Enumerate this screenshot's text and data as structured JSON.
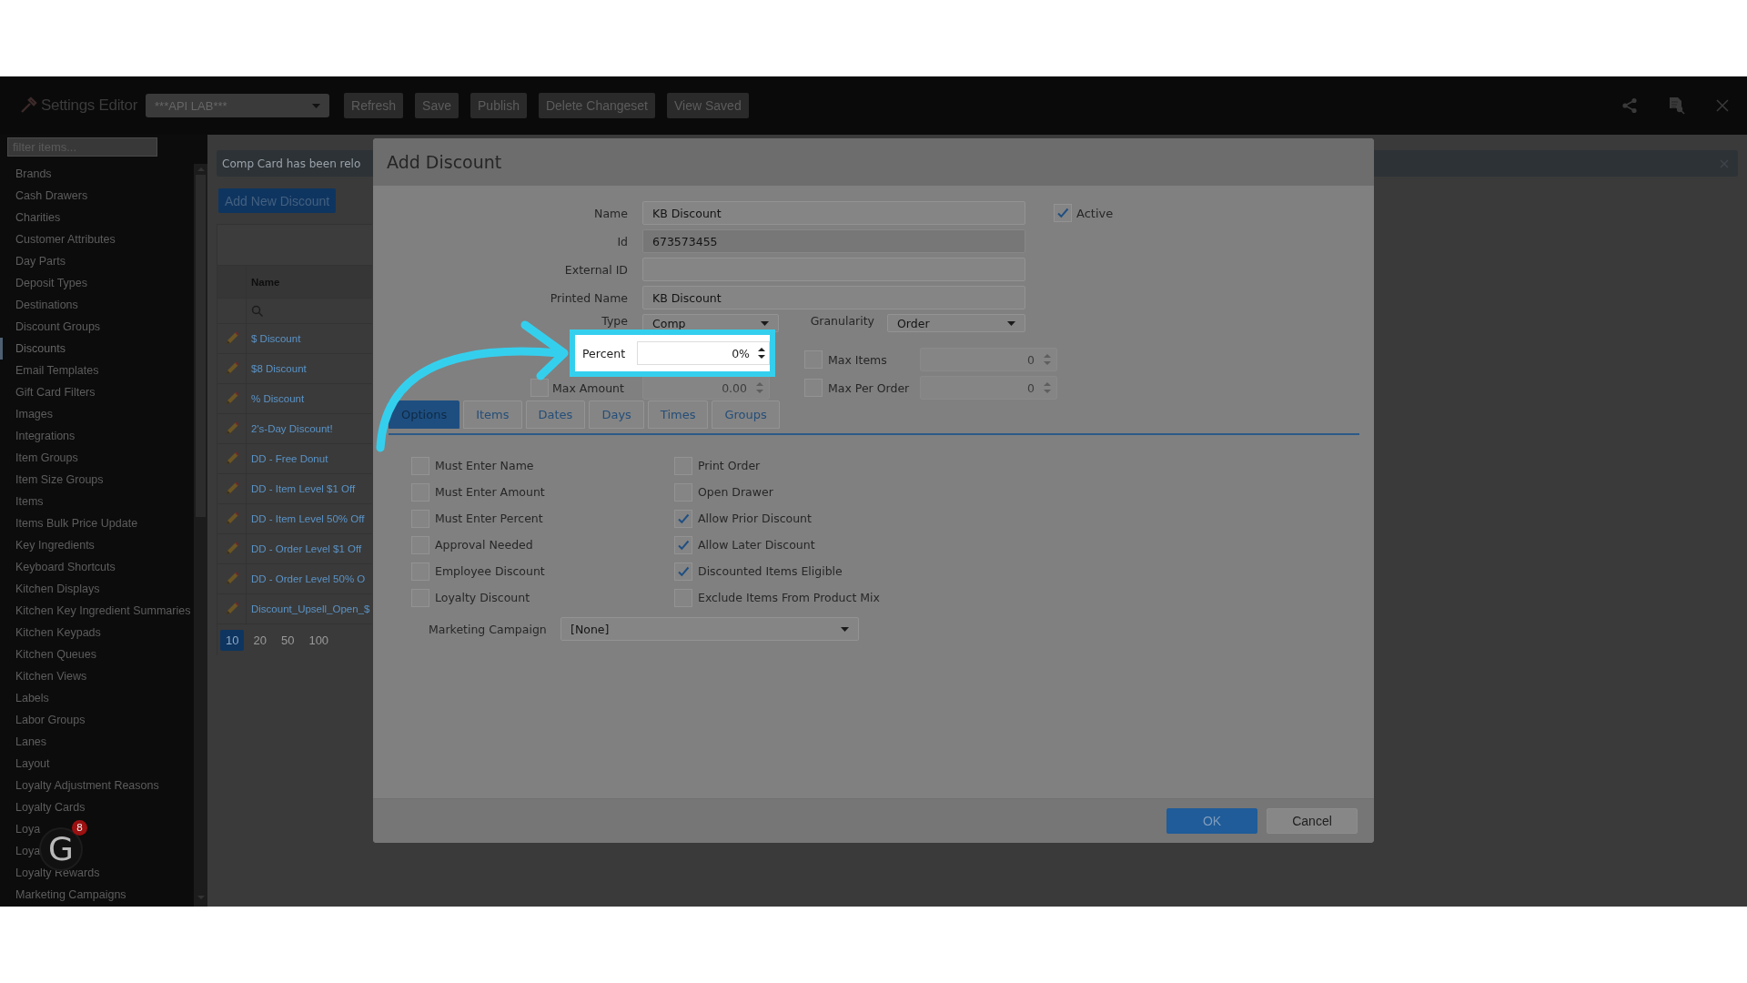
{
  "toolbar": {
    "app_title": "Settings Editor",
    "environment": "***API LAB***",
    "buttons": [
      "Refresh",
      "Save",
      "Publish",
      "Delete Changeset",
      "View Saved"
    ]
  },
  "sidebar": {
    "filter_placeholder": "filter items...",
    "items": [
      {
        "label": "Brands",
        "selected": false
      },
      {
        "label": "Cash Drawers",
        "selected": false
      },
      {
        "label": "Charities",
        "selected": false
      },
      {
        "label": "Customer Attributes",
        "selected": false
      },
      {
        "label": "Day Parts",
        "selected": false
      },
      {
        "label": "Deposit Types",
        "selected": false
      },
      {
        "label": "Destinations",
        "selected": false
      },
      {
        "label": "Discount Groups",
        "selected": false
      },
      {
        "label": "Discounts",
        "selected": true
      },
      {
        "label": "Email Templates",
        "selected": false
      },
      {
        "label": "Gift Card Filters",
        "selected": false
      },
      {
        "label": "Images",
        "selected": false
      },
      {
        "label": "Integrations",
        "selected": false
      },
      {
        "label": "Item Groups",
        "selected": false
      },
      {
        "label": "Item Size Groups",
        "selected": false
      },
      {
        "label": "Items",
        "selected": false
      },
      {
        "label": "Items Bulk Price Update",
        "selected": false
      },
      {
        "label": "Key Ingredients",
        "selected": false
      },
      {
        "label": "Keyboard Shortcuts",
        "selected": false
      },
      {
        "label": "Kitchen Displays",
        "selected": false
      },
      {
        "label": "Kitchen Key Ingredient Summaries",
        "selected": false
      },
      {
        "label": "Kitchen Keypads",
        "selected": false
      },
      {
        "label": "Kitchen Queues",
        "selected": false
      },
      {
        "label": "Kitchen Views",
        "selected": false
      },
      {
        "label": "Labels",
        "selected": false
      },
      {
        "label": "Labor Groups",
        "selected": false
      },
      {
        "label": "Lanes",
        "selected": false
      },
      {
        "label": "Layout",
        "selected": false
      },
      {
        "label": "Loyalty Adjustment Reasons",
        "selected": false
      },
      {
        "label": "Loyalty Cards",
        "selected": false
      },
      {
        "label": "Loya",
        "selected": false
      },
      {
        "label": "Loya",
        "selected": false
      },
      {
        "label": "Loyalty Rewards",
        "selected": false
      },
      {
        "label": "Marketing Campaigns",
        "selected": false
      }
    ]
  },
  "main": {
    "alert": "Comp Card has been relo",
    "add_button": "Add New Discount",
    "table": {
      "columns": [
        "Name"
      ],
      "rows": [
        "$ Discount",
        "$8 Discount",
        "% Discount",
        "2's-Day Discount!",
        "DD - Free Donut",
        "DD - Item Level $1 Off",
        "DD - Item Level 50% Off",
        "DD - Order Level $1 Off",
        "DD - Order Level 50% O",
        "Discount_Upsell_Open_$"
      ]
    },
    "page_sizes": [
      {
        "label": "10",
        "selected": true
      },
      {
        "label": "20",
        "selected": false
      },
      {
        "label": "50",
        "selected": false
      },
      {
        "label": "100",
        "selected": false
      }
    ]
  },
  "dialog": {
    "title": "Add Discount",
    "fields": [
      {
        "label": "Name",
        "value": "KB Discount",
        "readonly": false
      },
      {
        "label": "Id",
        "value": "673573455",
        "readonly": true
      },
      {
        "label": "External ID",
        "readonly": false
      },
      {
        "label": "Printed Name",
        "value": "KB Discount",
        "readonly": false
      }
    ],
    "active": {
      "label": "Active",
      "checked": true
    },
    "type": {
      "label": "Type",
      "value": "Comp"
    },
    "granularity": {
      "label": "Granularity",
      "value": "Order"
    },
    "percent": {
      "label": "Percent",
      "value": "0%"
    },
    "max_amount": {
      "label": "Max Amount",
      "value": "0.00",
      "checked": false,
      "disabled": true
    },
    "max_items": {
      "label": "Max Items",
      "value": "0",
      "checked": false,
      "disabled": true
    },
    "max_per_order": {
      "label": "Max Per Order",
      "value": "0",
      "checked": false,
      "disabled": true
    },
    "tabs": [
      {
        "label": "Options",
        "selected": true
      },
      {
        "label": "Items",
        "selected": false
      },
      {
        "label": "Dates",
        "selected": false
      },
      {
        "label": "Days",
        "selected": false
      },
      {
        "label": "Times",
        "selected": false
      },
      {
        "label": "Groups",
        "selected": false
      }
    ],
    "options_left": [
      {
        "label": "Must Enter Name",
        "checked": false
      },
      {
        "label": "Must Enter Amount",
        "checked": false
      },
      {
        "label": "Must Enter Percent",
        "checked": false
      },
      {
        "label": "Approval Needed",
        "checked": false
      },
      {
        "label": "Employee Discount",
        "checked": false
      },
      {
        "label": "Loyalty Discount",
        "checked": false
      }
    ],
    "options_right": [
      {
        "label": "Print Order",
        "checked": false
      },
      {
        "label": "Open Drawer",
        "checked": false
      },
      {
        "label": "Allow Prior Discount",
        "checked": true
      },
      {
        "label": "Allow Later Discount",
        "checked": true
      },
      {
        "label": "Discounted Items Eligible",
        "checked": true
      },
      {
        "label": "Exclude Items From Product Mix",
        "checked": false
      }
    ],
    "marketing_campaign": {
      "label": "Marketing Campaign",
      "value": "[None]"
    },
    "buttons": [
      {
        "label": "OK",
        "kind": "primary"
      },
      {
        "label": "Cancel",
        "kind": "default"
      }
    ]
  },
  "help_widget": {
    "letter": "G",
    "count": "8"
  }
}
